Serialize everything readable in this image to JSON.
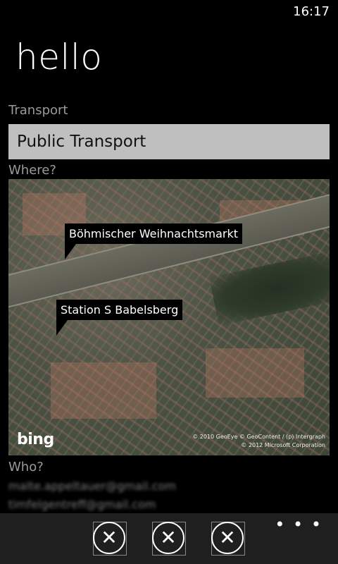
{
  "status": {
    "time": "16:17"
  },
  "page": {
    "title": "hello"
  },
  "form": {
    "transport_label": "Transport",
    "transport_value": "Public Transport",
    "where_label": "Where?",
    "who_label": "Who?",
    "emails": [
      "malte.appeltauer@gmail.com",
      "timfelgentreff@gmail.com"
    ]
  },
  "map": {
    "pins": [
      {
        "label": "Böhmischer Weihnachtsmarkt"
      },
      {
        "label": "Station S Babelsberg"
      }
    ],
    "logo": "bing",
    "copyright_line1": "© 2010 GeoEye  © GeoContent / (p) Intergraph",
    "copyright_line2": "© 2012 Microsoft Corporation"
  },
  "app_bar": {
    "buttons": [
      {
        "icon": "close-icon",
        "glyph": "✕"
      },
      {
        "icon": "close-icon",
        "glyph": "✕"
      },
      {
        "icon": "close-icon",
        "glyph": "✕"
      }
    ],
    "more_glyph": "• • •"
  }
}
